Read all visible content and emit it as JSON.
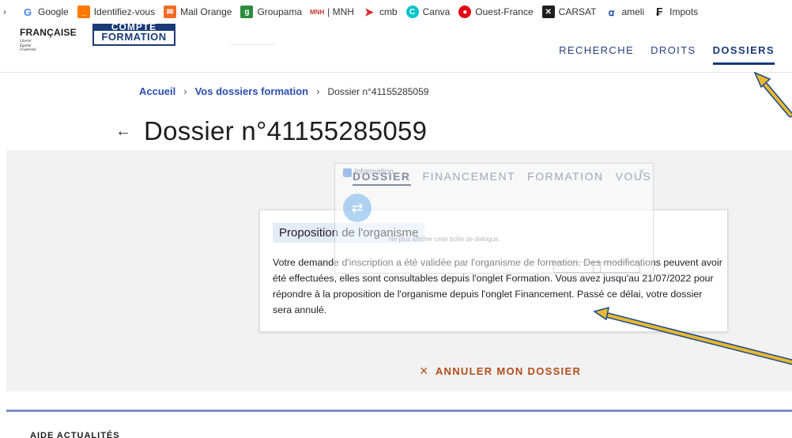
{
  "bookmarks": [
    {
      "label": "Google",
      "icon": "google-icon",
      "color": "#4285f4"
    },
    {
      "label": "Identifiez-vous",
      "icon": "orange-icon",
      "color": "#ff7900"
    },
    {
      "label": "Mail Orange",
      "icon": "mail-icon",
      "color": "#f26c23"
    },
    {
      "label": "Groupama",
      "icon": "groupama-icon",
      "color": "#2d8c3c"
    },
    {
      "label": "| MNH",
      "icon": "mnh-icon",
      "color": "#c0392b"
    },
    {
      "label": "cmb",
      "icon": "cmb-icon",
      "color": "#e3262f"
    },
    {
      "label": "Canva",
      "icon": "canva-icon",
      "color": "#00c4cc"
    },
    {
      "label": "Ouest-France",
      "icon": "ouest-france-icon",
      "color": "#e30613"
    },
    {
      "label": "CARSAT",
      "icon": "carsat-icon",
      "color": "#1e1e1e"
    },
    {
      "label": "ameli",
      "icon": "ameli-icon",
      "color": "#0c419a"
    },
    {
      "label": "Impots",
      "icon": "impots-icon",
      "color": "#1e1e1e"
    }
  ],
  "header": {
    "republique": "FRANÇAISE",
    "motto": [
      "Liberté",
      "Égalité",
      "Fraternité"
    ],
    "logo_top": "COMPTE",
    "logo_bottom": "FORMATION",
    "nav": [
      {
        "label": "RECHERCHE",
        "active": false
      },
      {
        "label": "DROITS",
        "active": false
      },
      {
        "label": "DOSSIERS",
        "active": true
      }
    ]
  },
  "breadcrumb": {
    "home": "Accueil",
    "section": "Vos dossiers formation",
    "current": "Dossier n°41155285059"
  },
  "page": {
    "back_icon": "←",
    "title": "Dossier n°41155285059"
  },
  "tabs": [
    {
      "label": "DOSSIER",
      "active": true
    },
    {
      "label": "FINANCEMENT",
      "active": false
    },
    {
      "label": "FORMATION",
      "active": false
    },
    {
      "label": "VOUS",
      "active": false
    }
  ],
  "overlay": {
    "title": "Information",
    "checkbox": "Ne plus afficher cette boîte de dialogue.",
    "close_icon": "×"
  },
  "card": {
    "heading": "Proposition de l'organisme",
    "body": "Votre demande d'inscription a été validée par l'organisme de formation. Des modifications peuvent avoir été effectuées, elles sont consultables depuis l'onglet Formation. Vous avez jusqu'au 21/07/2022 pour répondre à la proposition de l'organisme depuis l'onglet Financement. Passé ce délai, votre dossier sera annulé."
  },
  "cancel": {
    "icon": "×",
    "label": "ANNULER MON DOSSIER"
  },
  "footer": {
    "partial": "AIDE      ACTUALITÉS"
  },
  "colors": {
    "accent": "#1a3a78",
    "link": "#2a4db0",
    "cancel": "#b34d1a",
    "arrow": "#e8b830"
  }
}
